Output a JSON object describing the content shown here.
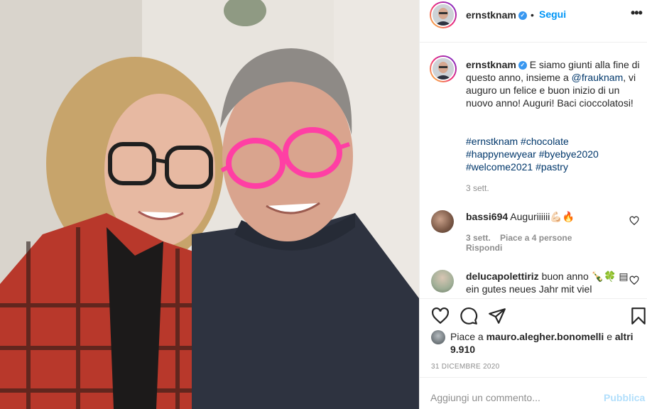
{
  "post": {
    "username": "ernstknam",
    "follow_label": "Segui",
    "separator": "•",
    "more_label": "•••"
  },
  "caption": {
    "username": "ernstknam",
    "text_1": "E siamo giunti alla fine di questo anno, insieme a",
    "mention": "@frauknam",
    "text_2": ", vi auguro un felice e buon inizio di un nuovo anno! Auguri! Baci cioccolatosi!",
    "hashtags": [
      "#ernstknam",
      "#chocolate",
      "#happynewyear",
      "#byebye2020",
      "#welcome2021",
      "#pastry"
    ],
    "time": "3 sett."
  },
  "comments": [
    {
      "username": "bassi694",
      "text": "Auguriiiiii💪🏻🔥",
      "time": "3 sett.",
      "likes": "Piace a 4 persone",
      "reply": "Rispondi"
    },
    {
      "username": "delucapolettiriz",
      "text": "buon anno 🍾🍀 ▤ ein gutes neues Jahr mit viel"
    }
  ],
  "likes": {
    "prefix": "Piace a",
    "user": "mauro.alegher.bonomelli",
    "connector": "e",
    "others": "altri 9.910"
  },
  "date": "31 DICEMBRE 2020",
  "add_comment": {
    "placeholder": "Aggiungi un commento...",
    "publish": "Pubblica"
  },
  "colors": {
    "accent": "#0095f6",
    "link": "#00376b",
    "muted": "#8e8e8e",
    "publish_disabled": "#b2dffc"
  },
  "icons": {
    "verified": "verified-badge-icon",
    "like": "heart-icon",
    "comment": "comment-bubble-icon",
    "share": "paper-plane-icon",
    "save": "bookmark-icon"
  }
}
